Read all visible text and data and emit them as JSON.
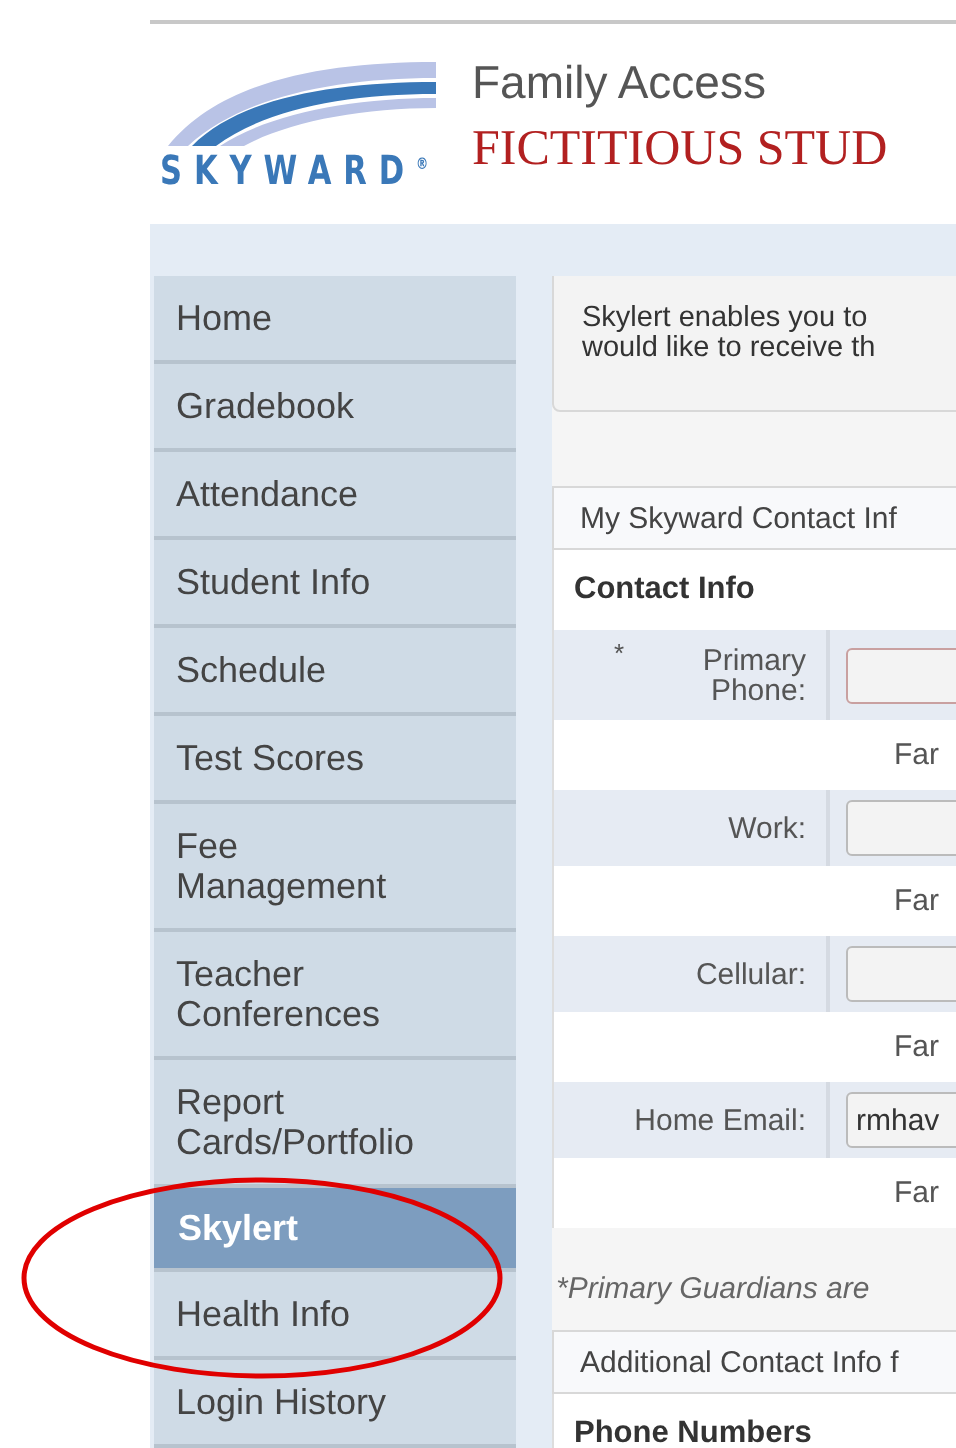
{
  "header": {
    "logo_text": "SKYWARD",
    "logo_mark": "®",
    "app_title": "Family Access",
    "student_name": "FICTITIOUS STUD"
  },
  "sidebar": {
    "items": [
      {
        "label": "Home",
        "selected": false
      },
      {
        "label": "Gradebook",
        "selected": false
      },
      {
        "label": "Attendance",
        "selected": false
      },
      {
        "label": "Student Info",
        "selected": false
      },
      {
        "label": "Schedule",
        "selected": false
      },
      {
        "label": "Test Scores",
        "selected": false
      },
      {
        "label": "Fee Management",
        "selected": false
      },
      {
        "label": "Teacher Conferences",
        "selected": false
      },
      {
        "label": "Report Cards/Portfolio",
        "selected": false
      },
      {
        "label": "Skylert",
        "selected": true
      },
      {
        "label": "Health Info",
        "selected": false
      },
      {
        "label": "Login History",
        "selected": false
      }
    ]
  },
  "notice": {
    "lines": [
      "Skylert enables you to",
      "would like to receive th"
    ]
  },
  "contact_section": {
    "title": "My Skyward Contact Inf",
    "subtitle": "Contact Info",
    "fields": [
      {
        "label": "Primary Phone:",
        "required_mark": "*",
        "required": true,
        "note": "Far"
      },
      {
        "label": "Work:",
        "required": false,
        "note": "Far"
      },
      {
        "label": "Cellular:",
        "required": false,
        "note": "Far"
      },
      {
        "label": "Home Email:",
        "value": "rmhav",
        "required": false,
        "note": "Far"
      }
    ]
  },
  "footnote": "*Primary Guardians are",
  "additional_section": {
    "title": "Additional Contact Info f",
    "subtitle": "Phone Numbers"
  }
}
